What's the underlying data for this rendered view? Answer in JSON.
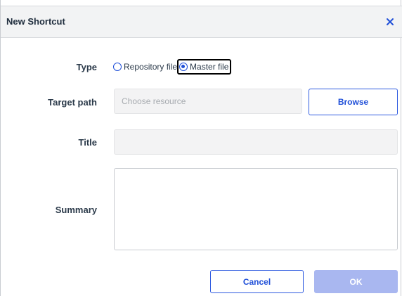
{
  "dialog": {
    "title": "New Shortcut",
    "close_icon": "close-icon"
  },
  "form": {
    "type_label": "Type",
    "type_options": [
      {
        "label": "Repository file",
        "checked": false
      },
      {
        "label": "Master file",
        "checked": true
      }
    ],
    "target_path_label": "Target path",
    "target_path_placeholder": "Choose resource",
    "browse_label": "Browse",
    "title_label": "Title",
    "title_value": "",
    "summary_label": "Summary",
    "summary_value": ""
  },
  "footer": {
    "cancel_label": "Cancel",
    "ok_label": "OK"
  },
  "colors": {
    "accent": "#1f4fd8",
    "disabled_button": "#a9b7f0",
    "header_bg": "#f2f3f4"
  }
}
